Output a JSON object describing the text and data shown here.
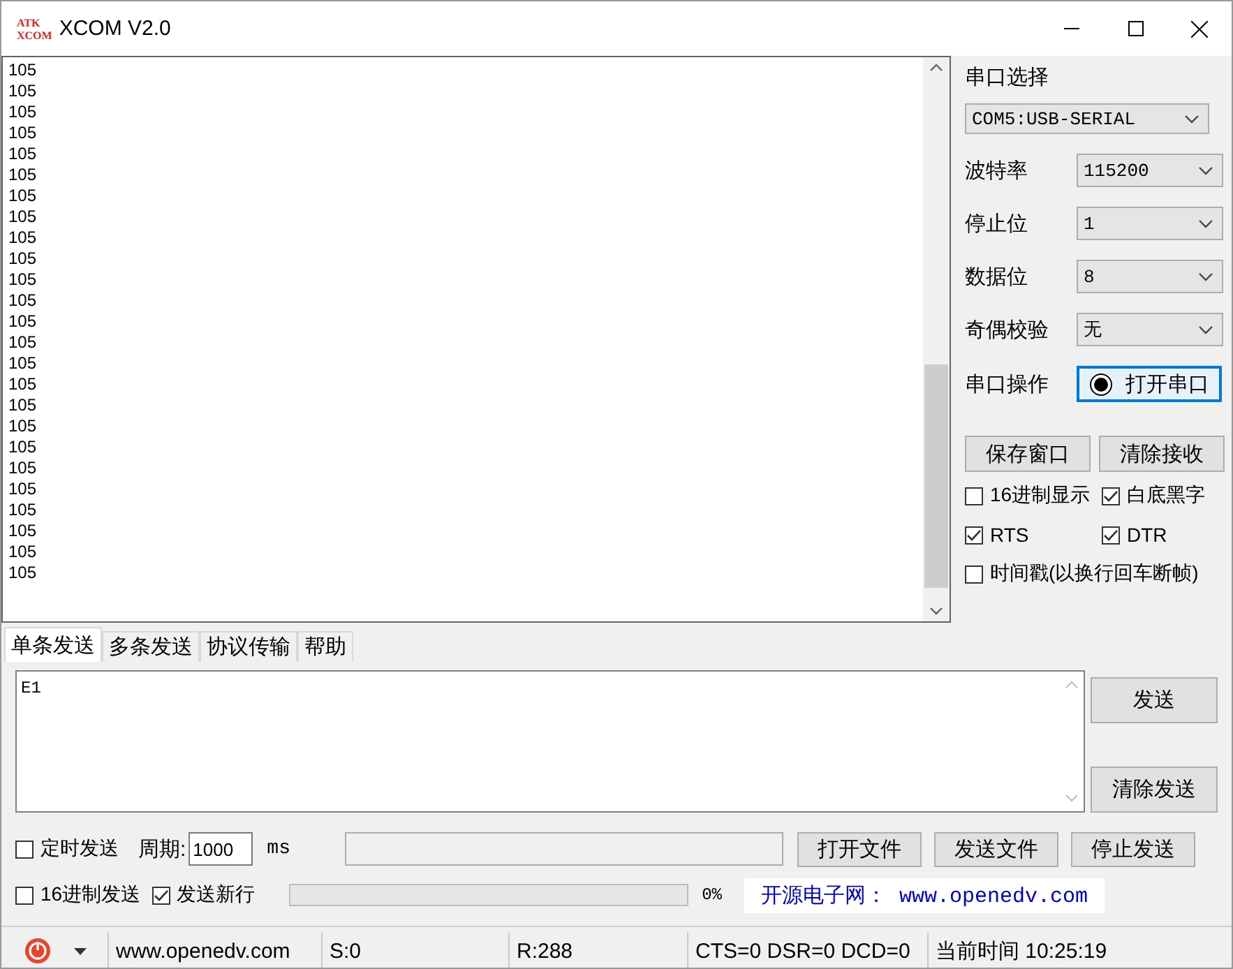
{
  "window": {
    "title": "XCOM V2.0",
    "logo_text": [
      "ATK",
      "XCOM"
    ]
  },
  "receive": {
    "lines": [
      "105",
      "105",
      "105",
      "105",
      "105",
      "105",
      "105",
      "105",
      "105",
      "105",
      "105",
      "105",
      "105",
      "105",
      "105",
      "105",
      "105",
      "105",
      "105",
      "105",
      "105",
      "105",
      "105",
      "105",
      "105"
    ]
  },
  "serial_panel": {
    "section_label": "串口选择",
    "port": "COM5:USB-SERIAL",
    "settings": [
      {
        "label": "波特率",
        "value": "115200"
      },
      {
        "label": "停止位",
        "value": "1"
      },
      {
        "label": "数据位",
        "value": "8"
      },
      {
        "label": "奇偶校验",
        "value": "无"
      }
    ],
    "operation_label": "串口操作",
    "open_button": "打开串口",
    "save_button": "保存窗口",
    "clear_button": "清除接收",
    "checkbox_rows": [
      [
        {
          "label": "16进制显示",
          "checked": false
        },
        {
          "label": "白底黑字",
          "checked": true
        }
      ],
      [
        {
          "label": "RTS",
          "checked": true
        },
        {
          "label": "DTR",
          "checked": true
        }
      ],
      [
        {
          "label": "时间戳(以换行回车断帧)",
          "checked": false
        }
      ]
    ]
  },
  "tabs": [
    {
      "label": "单条发送",
      "selected": true
    },
    {
      "label": "多条发送",
      "selected": false
    },
    {
      "label": "协议传输",
      "selected": false
    },
    {
      "label": "帮助",
      "selected": false
    }
  ],
  "send": {
    "value": "E1",
    "send_button": "发送",
    "clear_button": "清除发送",
    "timed_send": {
      "label": "定时发送",
      "checked": false
    },
    "period_label": "周期:",
    "period": "1000",
    "unit": "ms",
    "open_file_button": "打开文件",
    "send_file_button": "发送文件",
    "stop_button": "停止发送",
    "hex_send": {
      "label": "16进制发送",
      "checked": false
    },
    "newline": {
      "label": "发送新行",
      "checked": true
    },
    "progress": {
      "level": 0,
      "percent": "0%"
    },
    "banner": "开源电子网： www.openedv.com"
  },
  "status_bar": {
    "website": "www.openedv.com",
    "sent": "S:0",
    "received": "R:288",
    "lines": "CTS=0 DSR=0 DCD=0",
    "time": "当前时间 10:25:19"
  }
}
